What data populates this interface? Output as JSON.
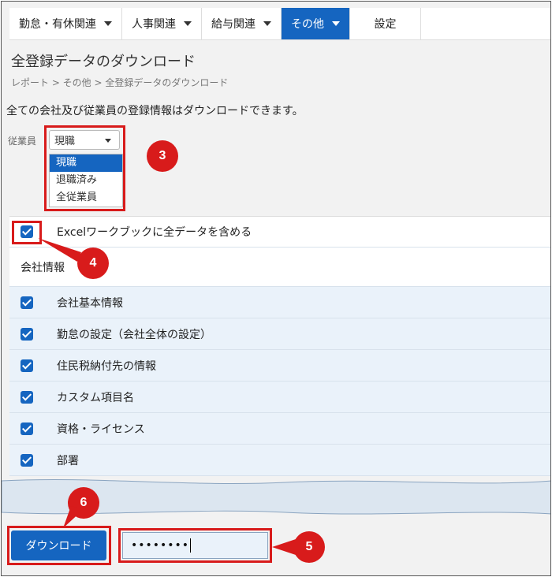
{
  "nav": {
    "items": [
      {
        "label": "勤怠・有休関連",
        "has_caret": true
      },
      {
        "label": "人事関連",
        "has_caret": true
      },
      {
        "label": "給与関連",
        "has_caret": true
      },
      {
        "label": "その他",
        "has_caret": true,
        "active": true
      },
      {
        "label": "設定",
        "has_caret": false
      }
    ]
  },
  "page": {
    "title": "全登録データのダウンロード",
    "breadcrumb": "レポート > その他 > 全登録データのダウンロード",
    "description": "全ての会社及び従業員の登録情報はダウンロードできます。"
  },
  "employee_filter": {
    "label": "従業員",
    "selected": "現職",
    "options": [
      "現職",
      "退職済み",
      "全従業員"
    ]
  },
  "excel_option": {
    "label": "Excelワークブックに全データを含める",
    "checked": true
  },
  "company_section": {
    "title": "会社情報"
  },
  "company_items": [
    {
      "label": "会社基本情報",
      "checked": true
    },
    {
      "label": "勤怠の設定（会社全体の設定）",
      "checked": true
    },
    {
      "label": "住民税納付先の情報",
      "checked": true
    },
    {
      "label": "カスタム項目名",
      "checked": true
    },
    {
      "label": "資格・ライセンス",
      "checked": true
    },
    {
      "label": "部署",
      "checked": true
    }
  ],
  "download_button": {
    "label": "ダウンロード"
  },
  "password_field": {
    "value": "••••••••"
  },
  "callouts": [
    "3",
    "4",
    "5",
    "6"
  ],
  "colors": {
    "accent": "#1565c0",
    "callout": "#d81b1b"
  }
}
